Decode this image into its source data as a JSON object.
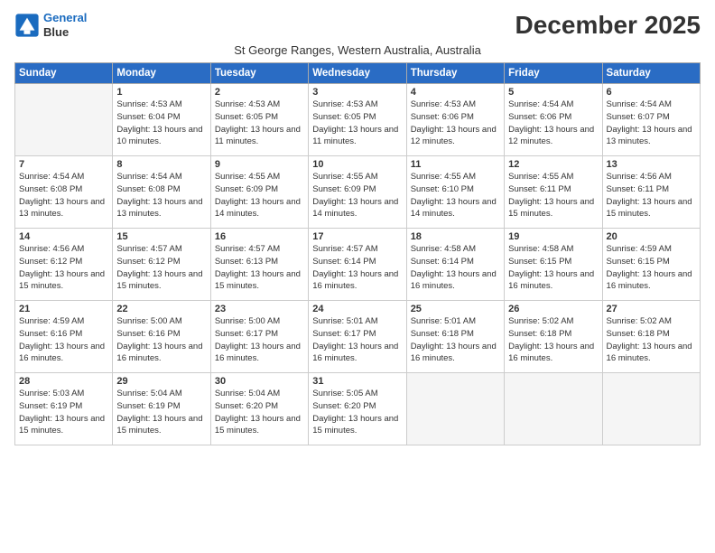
{
  "logo": {
    "line1": "General",
    "line2": "Blue"
  },
  "title": "December 2025",
  "subtitle": "St George Ranges, Western Australia, Australia",
  "headers": [
    "Sunday",
    "Monday",
    "Tuesday",
    "Wednesday",
    "Thursday",
    "Friday",
    "Saturday"
  ],
  "weeks": [
    [
      {
        "day": "",
        "empty": true
      },
      {
        "day": "1",
        "sunrise": "4:53 AM",
        "sunset": "6:04 PM",
        "daylight": "13 hours and 10 minutes."
      },
      {
        "day": "2",
        "sunrise": "4:53 AM",
        "sunset": "6:05 PM",
        "daylight": "13 hours and 11 minutes."
      },
      {
        "day": "3",
        "sunrise": "4:53 AM",
        "sunset": "6:05 PM",
        "daylight": "13 hours and 11 minutes."
      },
      {
        "day": "4",
        "sunrise": "4:53 AM",
        "sunset": "6:06 PM",
        "daylight": "13 hours and 12 minutes."
      },
      {
        "day": "5",
        "sunrise": "4:54 AM",
        "sunset": "6:06 PM",
        "daylight": "13 hours and 12 minutes."
      },
      {
        "day": "6",
        "sunrise": "4:54 AM",
        "sunset": "6:07 PM",
        "daylight": "13 hours and 13 minutes."
      }
    ],
    [
      {
        "day": "7",
        "sunrise": "4:54 AM",
        "sunset": "6:08 PM",
        "daylight": "13 hours and 13 minutes."
      },
      {
        "day": "8",
        "sunrise": "4:54 AM",
        "sunset": "6:08 PM",
        "daylight": "13 hours and 13 minutes."
      },
      {
        "day": "9",
        "sunrise": "4:55 AM",
        "sunset": "6:09 PM",
        "daylight": "13 hours and 14 minutes."
      },
      {
        "day": "10",
        "sunrise": "4:55 AM",
        "sunset": "6:09 PM",
        "daylight": "13 hours and 14 minutes."
      },
      {
        "day": "11",
        "sunrise": "4:55 AM",
        "sunset": "6:10 PM",
        "daylight": "13 hours and 14 minutes."
      },
      {
        "day": "12",
        "sunrise": "4:55 AM",
        "sunset": "6:11 PM",
        "daylight": "13 hours and 15 minutes."
      },
      {
        "day": "13",
        "sunrise": "4:56 AM",
        "sunset": "6:11 PM",
        "daylight": "13 hours and 15 minutes."
      }
    ],
    [
      {
        "day": "14",
        "sunrise": "4:56 AM",
        "sunset": "6:12 PM",
        "daylight": "13 hours and 15 minutes."
      },
      {
        "day": "15",
        "sunrise": "4:57 AM",
        "sunset": "6:12 PM",
        "daylight": "13 hours and 15 minutes."
      },
      {
        "day": "16",
        "sunrise": "4:57 AM",
        "sunset": "6:13 PM",
        "daylight": "13 hours and 15 minutes."
      },
      {
        "day": "17",
        "sunrise": "4:57 AM",
        "sunset": "6:14 PM",
        "daylight": "13 hours and 16 minutes."
      },
      {
        "day": "18",
        "sunrise": "4:58 AM",
        "sunset": "6:14 PM",
        "daylight": "13 hours and 16 minutes."
      },
      {
        "day": "19",
        "sunrise": "4:58 AM",
        "sunset": "6:15 PM",
        "daylight": "13 hours and 16 minutes."
      },
      {
        "day": "20",
        "sunrise": "4:59 AM",
        "sunset": "6:15 PM",
        "daylight": "13 hours and 16 minutes."
      }
    ],
    [
      {
        "day": "21",
        "sunrise": "4:59 AM",
        "sunset": "6:16 PM",
        "daylight": "13 hours and 16 minutes."
      },
      {
        "day": "22",
        "sunrise": "5:00 AM",
        "sunset": "6:16 PM",
        "daylight": "13 hours and 16 minutes."
      },
      {
        "day": "23",
        "sunrise": "5:00 AM",
        "sunset": "6:17 PM",
        "daylight": "13 hours and 16 minutes."
      },
      {
        "day": "24",
        "sunrise": "5:01 AM",
        "sunset": "6:17 PM",
        "daylight": "13 hours and 16 minutes."
      },
      {
        "day": "25",
        "sunrise": "5:01 AM",
        "sunset": "6:18 PM",
        "daylight": "13 hours and 16 minutes."
      },
      {
        "day": "26",
        "sunrise": "5:02 AM",
        "sunset": "6:18 PM",
        "daylight": "13 hours and 16 minutes."
      },
      {
        "day": "27",
        "sunrise": "5:02 AM",
        "sunset": "6:18 PM",
        "daylight": "13 hours and 16 minutes."
      }
    ],
    [
      {
        "day": "28",
        "sunrise": "5:03 AM",
        "sunset": "6:19 PM",
        "daylight": "13 hours and 15 minutes."
      },
      {
        "day": "29",
        "sunrise": "5:04 AM",
        "sunset": "6:19 PM",
        "daylight": "13 hours and 15 minutes."
      },
      {
        "day": "30",
        "sunrise": "5:04 AM",
        "sunset": "6:20 PM",
        "daylight": "13 hours and 15 minutes."
      },
      {
        "day": "31",
        "sunrise": "5:05 AM",
        "sunset": "6:20 PM",
        "daylight": "13 hours and 15 minutes."
      },
      {
        "day": "",
        "empty": true
      },
      {
        "day": "",
        "empty": true
      },
      {
        "day": "",
        "empty": true
      }
    ]
  ]
}
